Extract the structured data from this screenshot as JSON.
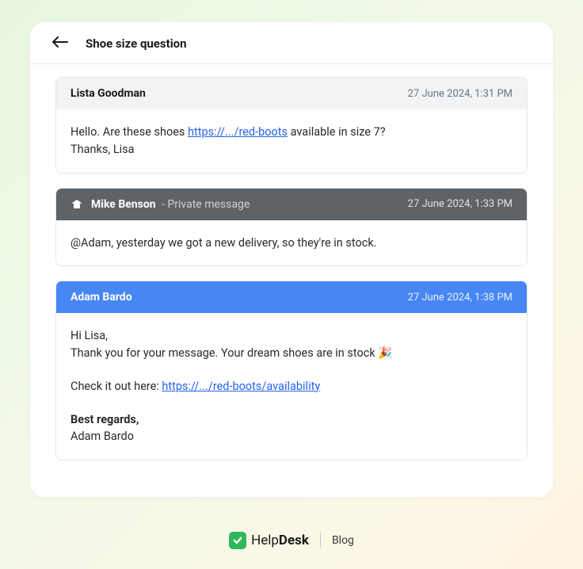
{
  "header": {
    "title": "Shoe size question"
  },
  "messages": {
    "customer": {
      "author": "Lista Goodman",
      "timestamp": "27 June 2024, 1:31 PM",
      "body_prefix": "Hello. Are these shoes ",
      "link_text": "https://.../red-boots",
      "body_suffix": " available in size 7?",
      "line2": "Thanks, Lisa"
    },
    "internal": {
      "author": "Mike Benson",
      "tag": " - Private message",
      "timestamp": "27 June 2024, 1:33 PM",
      "body": "@Adam, yesterday we got a new delivery, so they're in stock."
    },
    "agent": {
      "author": "Adam Bardo",
      "timestamp": "27 June 2024, 1:38 PM",
      "greeting": "Hi Lisa,",
      "line2": "Thank you for your message. Your dream shoes are in stock 🎉",
      "checkit_prefix": "Check it out here: ",
      "link_text": "https://.../red-boots/availability",
      "signoff": "Best regards,",
      "signature": "Adam Bardo"
    }
  },
  "footer": {
    "brand_help": "Help",
    "brand_desk": "Desk",
    "blog": "Blog"
  }
}
